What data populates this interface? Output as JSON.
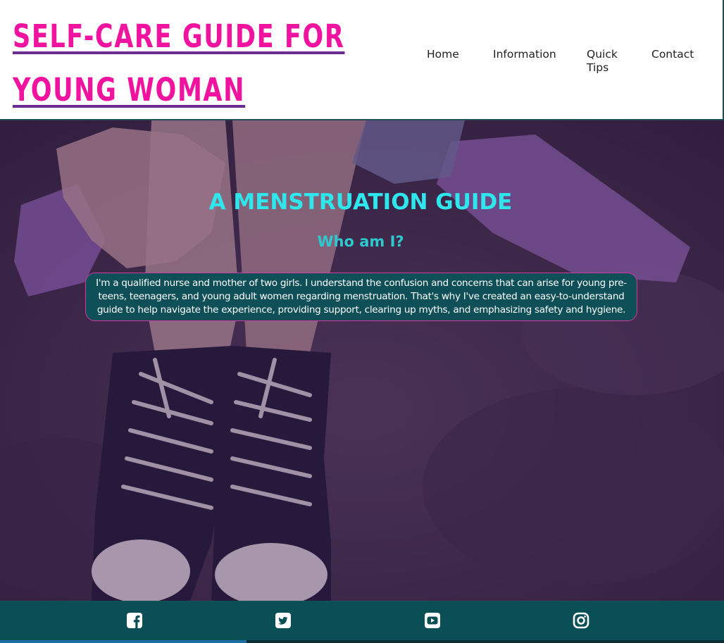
{
  "header": {
    "title_line1": "SELF-CARE GUIDE FOR",
    "title_line2": "YOUNG WOMAN",
    "nav": {
      "home": "Home",
      "information": "Information",
      "quick_tips": "Quick Tips",
      "contact": "Contact"
    }
  },
  "hero": {
    "heading": "A MENSTRUATION GUIDE",
    "subheading": "Who am I?",
    "intro": "I'm a qualified nurse and mother of two girls. I understand the confusion and concerns that can arise for young pre-teens, teenagers, and young adult women regarding menstruation. That's why I've created an easy-to-understand guide to help navigate the experience, providing support, clearing up myths, and emphasizing safety and hygiene."
  },
  "footer": {
    "social_icons": [
      "facebook-icon",
      "twitter-icon",
      "youtube-icon",
      "instagram-icon"
    ]
  },
  "colors": {
    "title": "#f0139f",
    "title_underline": "#6b2c91",
    "heading": "#2ee6ec",
    "intro_bg": "#0e4f58",
    "intro_border": "#d43aa0",
    "footer_bg": "#0b4f56"
  }
}
